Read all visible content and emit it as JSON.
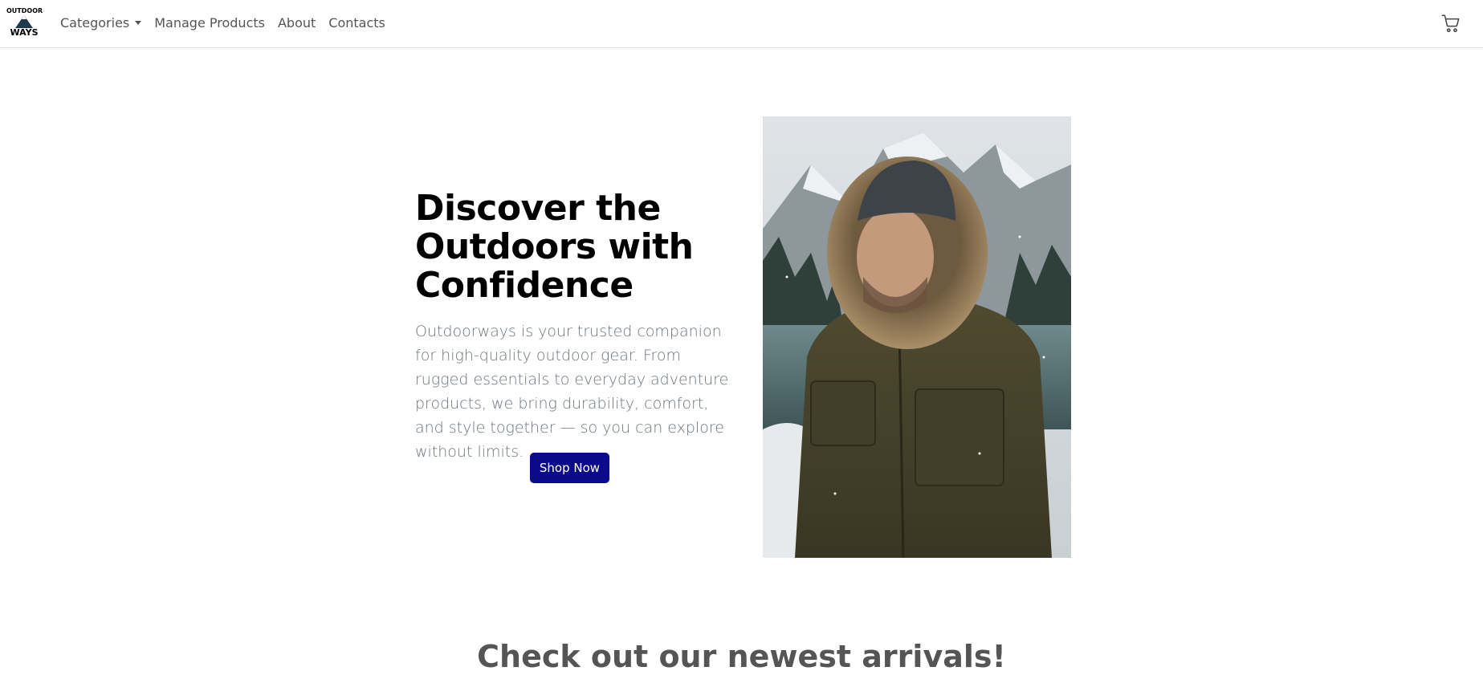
{
  "brand": {
    "logo_top": "OUTDOOR",
    "logo_bottom": "WAYS"
  },
  "nav": {
    "items": [
      {
        "label": "Categories",
        "dropdown": true
      },
      {
        "label": "Manage Products"
      },
      {
        "label": "About"
      },
      {
        "label": "Contacts"
      }
    ],
    "cart_icon": "shopping-cart-icon"
  },
  "hero": {
    "title": "Discover the Outdoors with Confidence",
    "description": "Outdoorways is your trusted companion for high-quality outdoor gear. From rugged essentials to everyday adventure products, we bring durability, comfort, and style together — so you can explore without limits.",
    "button_label": "Shop Now",
    "button_color": "#0a0a8a"
  },
  "arrivals": {
    "title": "Check out our newest arrivals!"
  }
}
